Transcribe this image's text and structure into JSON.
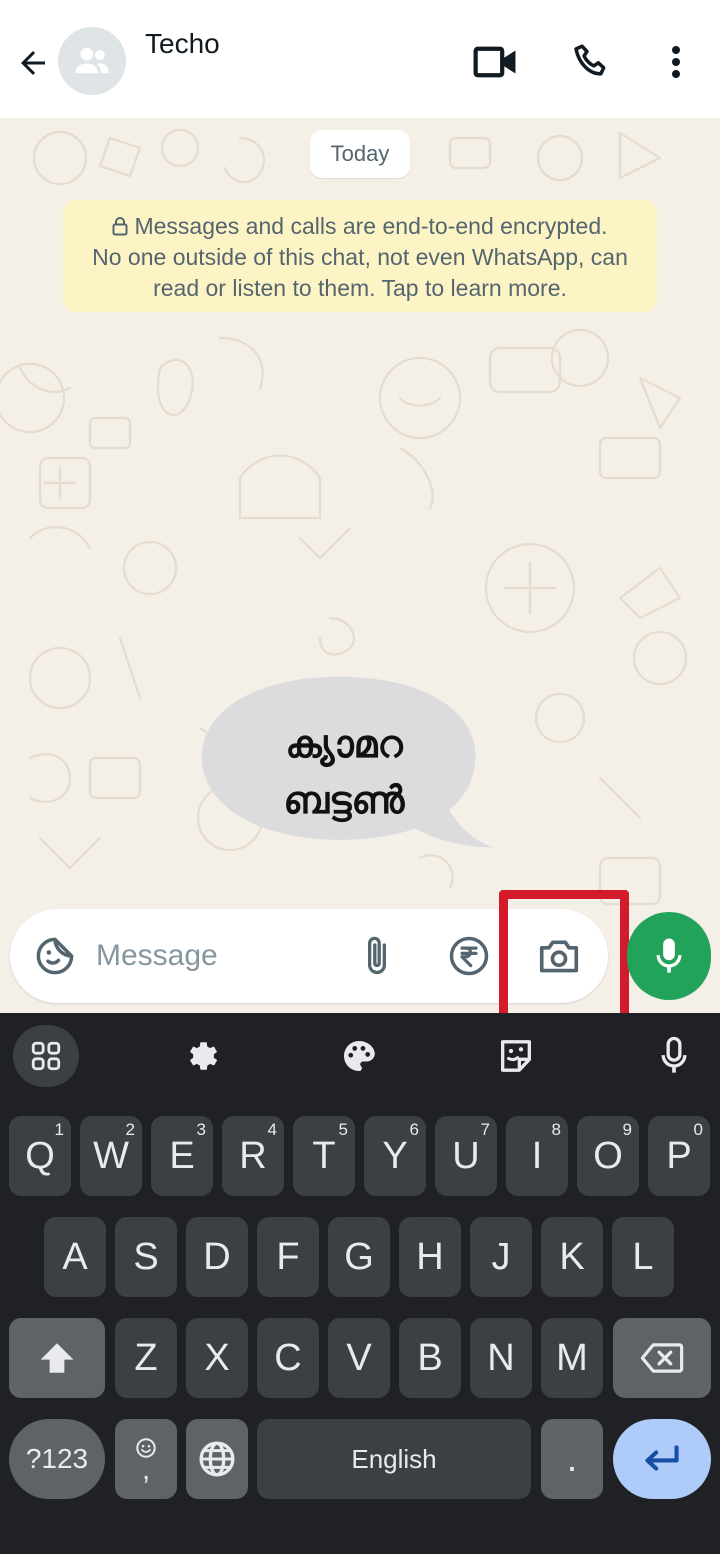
{
  "header": {
    "contact_name": "Techo",
    "icons": [
      "back-arrow-icon",
      "group-avatar-icon",
      "video-call-icon",
      "phone-icon",
      "more-vert-icon"
    ]
  },
  "chat": {
    "date_chip": "Today",
    "encryption_notice": {
      "line1": "Messages and calls are end-to-end encrypted.",
      "line2": "No one outside of this chat, not even WhatsApp, can",
      "line3": "read or listen to them. Tap to learn more."
    },
    "callout": {
      "line1": "ക്യാമറ",
      "line2": "ബട്ടൺ"
    }
  },
  "input_bar": {
    "placeholder": "Message",
    "icons": [
      "sticker-emoji-icon",
      "attach-icon",
      "rupee-payment-icon",
      "camera-icon",
      "mic-icon"
    ]
  },
  "keyboard": {
    "row1": [
      {
        "label": "Q",
        "num": "1"
      },
      {
        "label": "W",
        "num": "2"
      },
      {
        "label": "E",
        "num": "3"
      },
      {
        "label": "R",
        "num": "4"
      },
      {
        "label": "T",
        "num": "5"
      },
      {
        "label": "Y",
        "num": "6"
      },
      {
        "label": "U",
        "num": "7"
      },
      {
        "label": "I",
        "num": "8"
      },
      {
        "label": "O",
        "num": "9"
      },
      {
        "label": "P",
        "num": "0"
      }
    ],
    "row2": [
      "A",
      "S",
      "D",
      "F",
      "G",
      "H",
      "J",
      "K",
      "L"
    ],
    "row3": [
      "Z",
      "X",
      "C",
      "V",
      "B",
      "N",
      "M"
    ],
    "symbols_label": "?123",
    "comma_label": ",",
    "space_label": "English",
    "period_label": ".",
    "colors": {
      "background": "#202124",
      "key": "#3c4043",
      "fn_key": "#5f6368",
      "enter": "#aecbfa"
    }
  },
  "colors": {
    "accent_green": "#21a35a",
    "highlight_red": "#d41b2c",
    "notice_bg": "#fdf4c5"
  }
}
